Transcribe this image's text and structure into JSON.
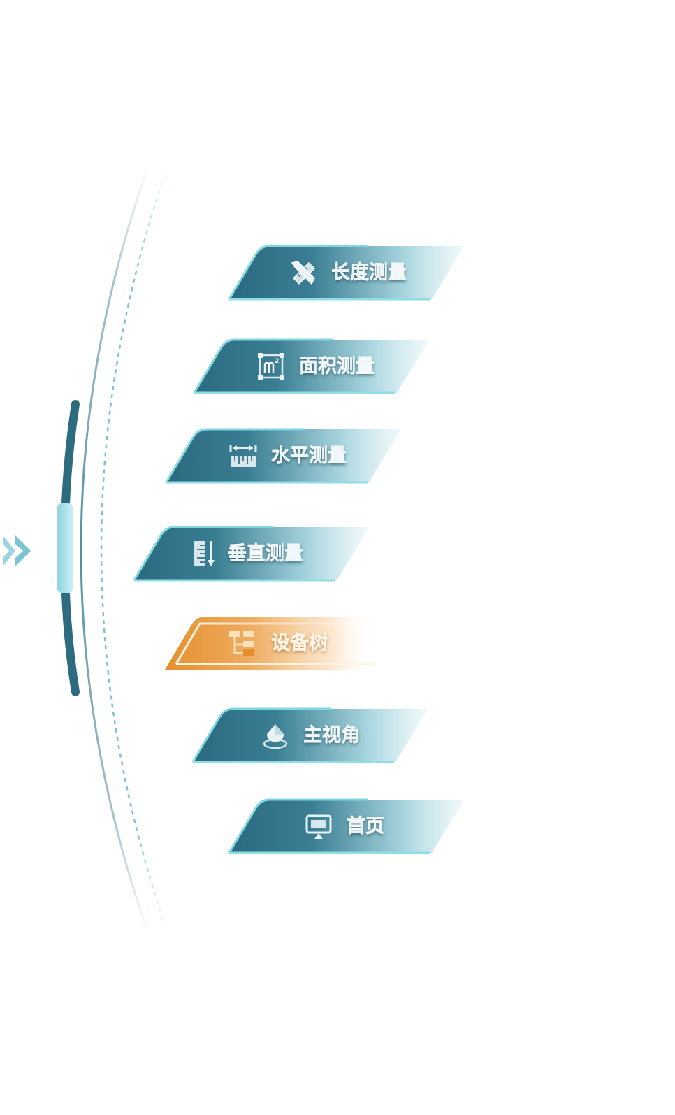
{
  "nav": {
    "expand_icon": "double-chevron-right-icon",
    "items": [
      {
        "label": "长度测量",
        "icon": "ruler-pencil-icon",
        "state": "normal"
      },
      {
        "label": "面积测量",
        "icon": "area-square-meter-icon",
        "state": "normal"
      },
      {
        "label": "水平测量",
        "icon": "horizontal-ruler-icon",
        "state": "normal"
      },
      {
        "label": "垂直测量",
        "icon": "vertical-ruler-icon",
        "state": "normal"
      },
      {
        "label": "设备树",
        "icon": "device-tree-icon",
        "state": "active"
      },
      {
        "label": "主视角",
        "icon": "main-view-icon",
        "state": "normal"
      },
      {
        "label": "首页",
        "icon": "monitor-home-icon",
        "state": "normal"
      }
    ]
  },
  "colors": {
    "button_teal_dark": "#2f6f86",
    "button_teal_light": "#d8eef2",
    "button_edge": "#6fd0dc",
    "active_orange": "#e89a3c",
    "active_orange_light": "#fde7cc",
    "arc_dark": "#2d6b7e",
    "arc_light": "#8fd2e0",
    "chevron": "#8fd0df"
  }
}
